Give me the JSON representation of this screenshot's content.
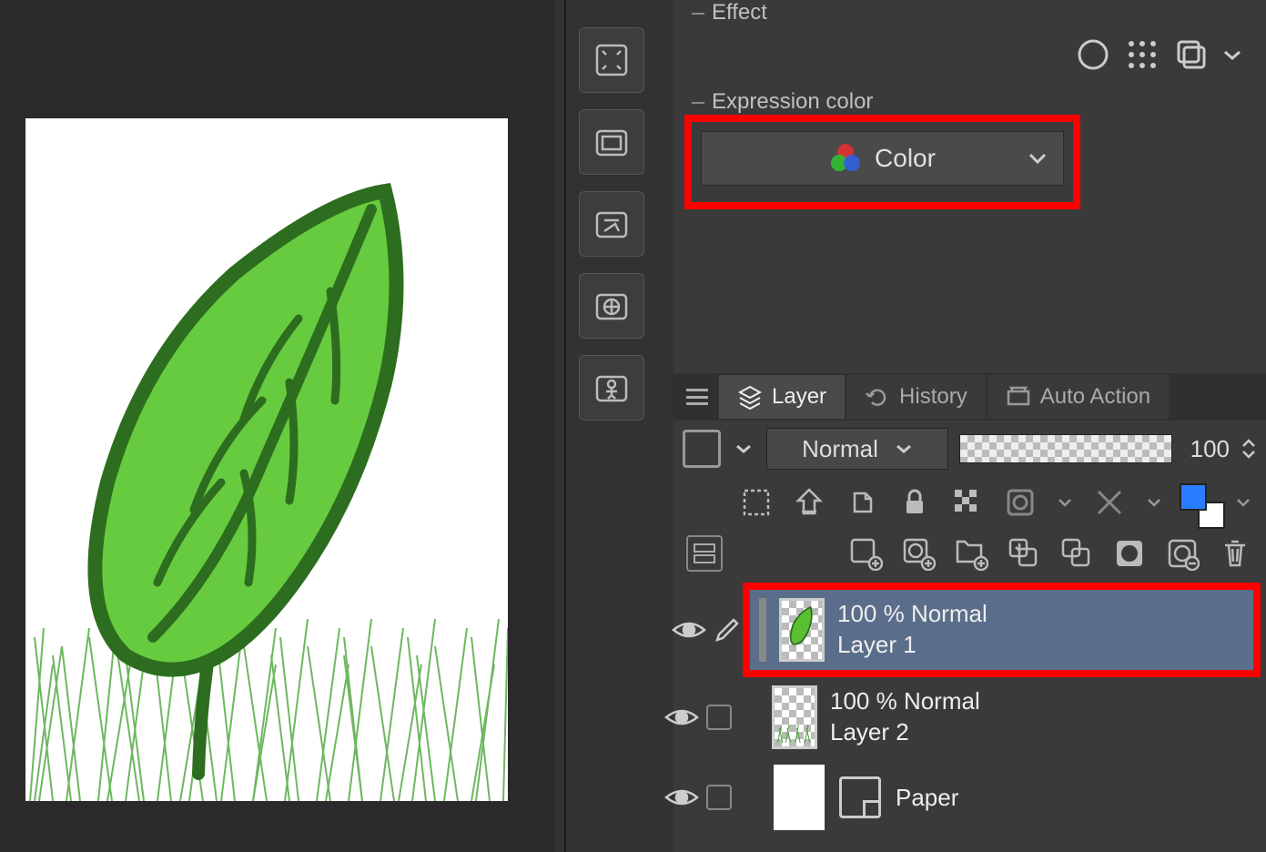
{
  "effect": {
    "label": "Effect"
  },
  "expression": {
    "label": "Expression color",
    "dropdown_value": "Color"
  },
  "tabs": {
    "layer": "Layer",
    "history": "History",
    "auto_action": "Auto Action"
  },
  "layer_panel": {
    "blend_mode": "Normal",
    "opacity": "100",
    "layers": [
      {
        "opacity_mode": "100 % Normal",
        "name": "Layer 1",
        "selected": true
      },
      {
        "opacity_mode": "100 % Normal",
        "name": "Layer 2",
        "selected": false
      }
    ],
    "paper": "Paper"
  }
}
